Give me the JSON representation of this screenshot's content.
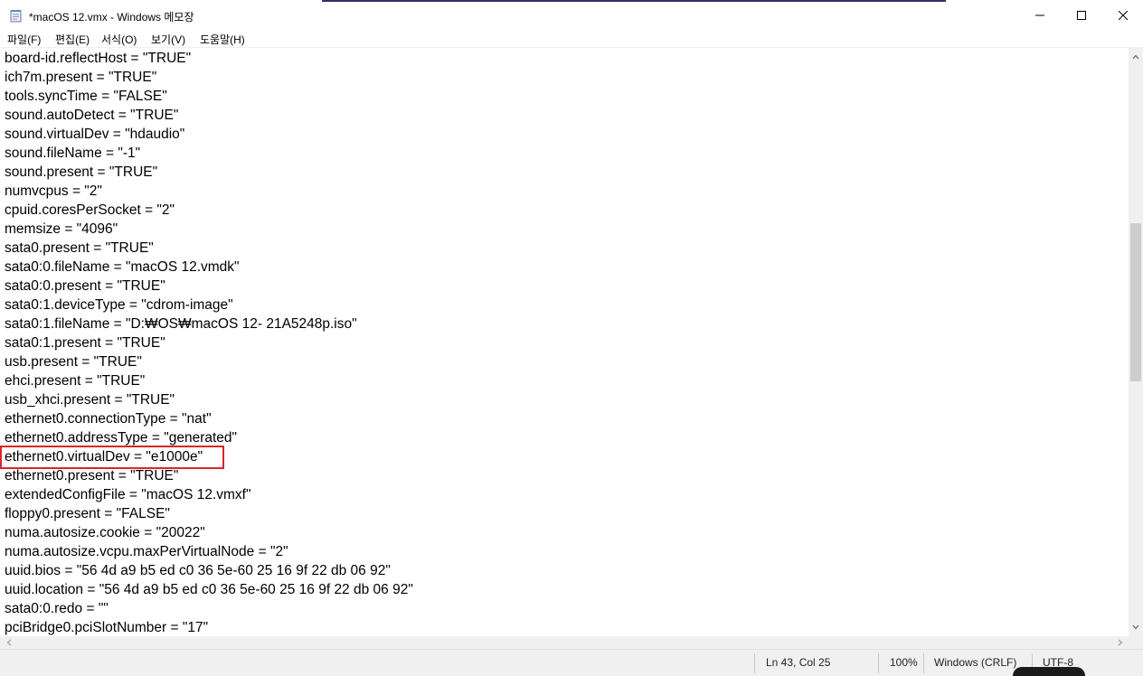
{
  "window": {
    "title": "*macOS 12.vmx - Windows 메모장"
  },
  "menu": {
    "items": [
      {
        "label": "파일(F)"
      },
      {
        "label": "편집(E)"
      },
      {
        "label": "서식(O)"
      },
      {
        "label": "보기(V)"
      },
      {
        "label": "도움말(H)"
      }
    ]
  },
  "editor": {
    "lines": [
      "board-id.reflectHost = \"TRUE\"",
      "ich7m.present = \"TRUE\"",
      "tools.syncTime = \"FALSE\"",
      "sound.autoDetect = \"TRUE\"",
      "sound.virtualDev = \"hdaudio\"",
      "sound.fileName = \"-1\"",
      "sound.present = \"TRUE\"",
      "numvcpus = \"2\"",
      "cpuid.coresPerSocket = \"2\"",
      "memsize = \"4096\"",
      "sata0.present = \"TRUE\"",
      "sata0:0.fileName = \"macOS 12.vmdk\"",
      "sata0:0.present = \"TRUE\"",
      "sata0:1.deviceType = \"cdrom-image\"",
      "sata0:1.fileName = \"D:₩OS₩macOS 12- 21A5248p.iso\"",
      "sata0:1.present = \"TRUE\"",
      "usb.present = \"TRUE\"",
      "ehci.present = \"TRUE\"",
      "usb_xhci.present = \"TRUE\"",
      "ethernet0.connectionType = \"nat\"",
      "ethernet0.addressType = \"generated\"",
      "ethernet0.virtualDev = \"e1000e\"",
      "ethernet0.present = \"TRUE\"",
      "extendedConfigFile = \"macOS 12.vmxf\"",
      "floppy0.present = \"FALSE\"",
      "numa.autosize.cookie = \"20022\"",
      "numa.autosize.vcpu.maxPerVirtualNode = \"2\"",
      "uuid.bios = \"56 4d a9 b5 ed c0 36 5e-60 25 16 9f 22 db 06 92\"",
      "uuid.location = \"56 4d a9 b5 ed c0 36 5e-60 25 16 9f 22 db 06 92\"",
      "sata0:0.redo = \"\"",
      "pciBridge0.pciSlotNumber = \"17\""
    ],
    "highlighted_line_index": 21,
    "highlight_color": "#d9262b"
  },
  "status": {
    "position": "Ln 43, Col 25",
    "zoom": "100%",
    "line_ending": "Windows (CRLF)",
    "encoding": "UTF-8"
  },
  "icons": {
    "app": "notepad-icon",
    "minimize": "minimize-icon",
    "maximize": "maximize-icon",
    "close": "close-icon"
  }
}
